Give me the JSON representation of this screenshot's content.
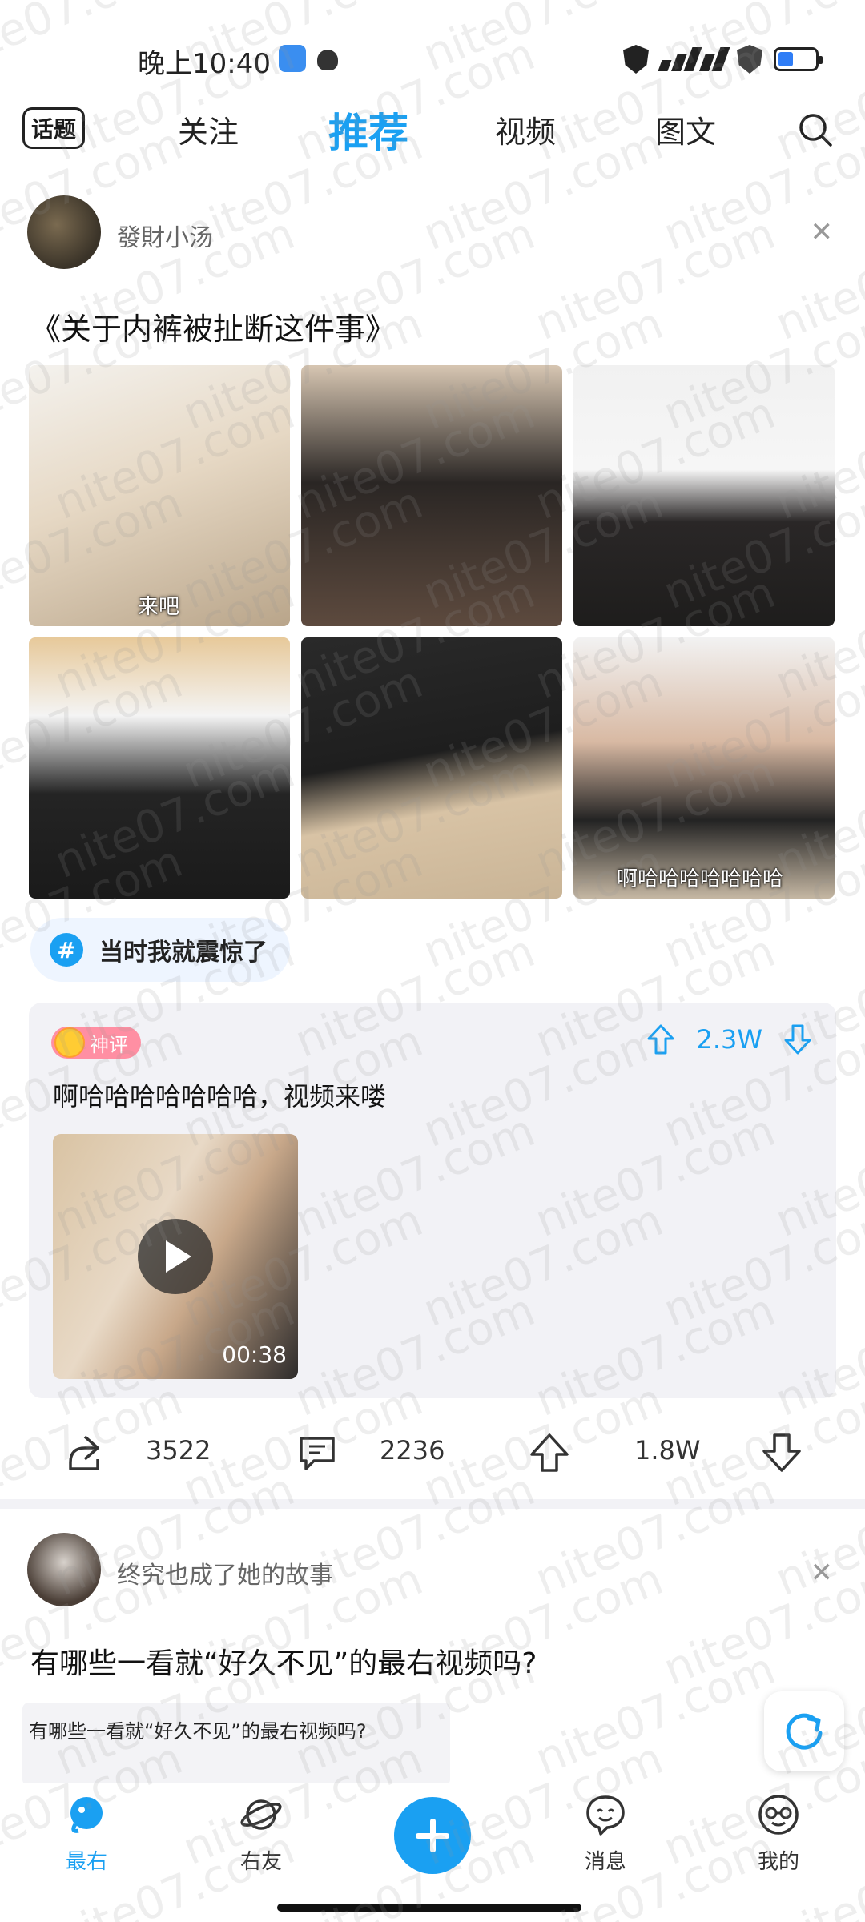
{
  "status_bar": {
    "time": "晚上10:40"
  },
  "top_nav": {
    "topic_label": "话题",
    "tabs": [
      {
        "label": "关注",
        "active": false
      },
      {
        "label": "推荐",
        "active": true
      },
      {
        "label": "视频",
        "active": false
      },
      {
        "label": "图文",
        "active": false
      }
    ]
  },
  "post1": {
    "username": "發財小汤",
    "title": "《关于内裤被扯断这件事》",
    "images": [
      {
        "caption": "来吧"
      },
      {
        "caption": ""
      },
      {
        "caption": ""
      },
      {
        "caption": ""
      },
      {
        "caption": ""
      },
      {
        "caption": "啊哈哈哈哈哈哈哈"
      }
    ],
    "hashtag": "当时我就震惊了",
    "god_comment": {
      "badge": "神评",
      "votes": "2.3W",
      "text": "啊哈哈哈哈哈哈哈，视频来喽",
      "video_duration": "00:38"
    },
    "actions": {
      "share_count": "3522",
      "comment_count": "2236",
      "like_count": "1.8W"
    }
  },
  "post2": {
    "username": "终究也成了她的故事",
    "title": "有哪些一看就“好久不见”的最右视频吗?",
    "sub_text": "有哪些一看就“好久不见”的最右视频吗?"
  },
  "bottom_nav": {
    "items": [
      {
        "label": "最右",
        "active": true
      },
      {
        "label": "右友",
        "active": false
      },
      {
        "label": "消息",
        "active": false
      },
      {
        "label": "我的",
        "active": false
      }
    ]
  },
  "watermark": "nite07.com",
  "colors": {
    "accent": "#1aa0f2",
    "badge": "#ff8fa3",
    "card_bg": "#f2f2f6"
  }
}
